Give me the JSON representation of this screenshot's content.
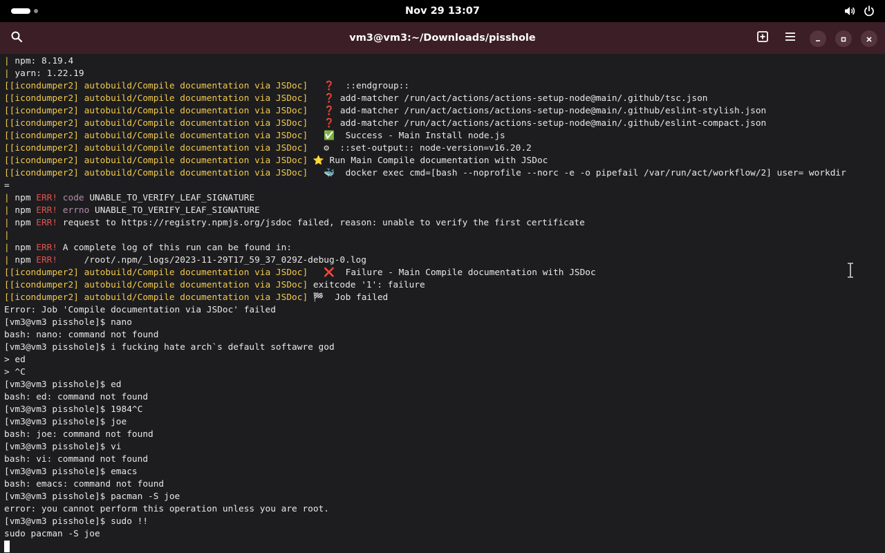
{
  "topbar": {
    "clock": "Nov 29  13:07",
    "icons": [
      "volume-icon",
      "power-icon"
    ]
  },
  "window": {
    "title": "vm3@vm3:~/Downloads/pisshole",
    "buttons": [
      "search-icon",
      "new-tab-icon",
      "menu-icon",
      "minimize-icon",
      "maximize-icon",
      "close-icon"
    ]
  },
  "colors": {
    "topbar_bg": "#000000",
    "headerbar_bg": "#3b1e26",
    "terminal_bg": "#1d1d1f",
    "prefix_yellow": "#f2c94c",
    "err_red": "#e0524f",
    "code_purple": "#b48ead"
  },
  "terminal": {
    "lines": [
      [
        {
          "t": "| ",
          "c": "y"
        },
        {
          "t": "npm: 8.19.4"
        }
      ],
      [
        {
          "t": "| ",
          "c": "y"
        },
        {
          "t": "yarn: 1.22.19"
        }
      ],
      [
        {
          "t": "[[icondumper2] autobuild/Compile documentation via JSDoc]",
          "c": "y"
        },
        {
          "t": "   ❓  ::endgroup::"
        }
      ],
      [
        {
          "t": "[[icondumper2] autobuild/Compile documentation via JSDoc]",
          "c": "y"
        },
        {
          "t": "   ❓ add-matcher /run/act/actions/actions-setup-node@main/.github/tsc.json"
        }
      ],
      [
        {
          "t": "[[icondumper2] autobuild/Compile documentation via JSDoc]",
          "c": "y"
        },
        {
          "t": "   ❓ add-matcher /run/act/actions/actions-setup-node@main/.github/eslint-stylish.json"
        }
      ],
      [
        {
          "t": "[[icondumper2] autobuild/Compile documentation via JSDoc]",
          "c": "y"
        },
        {
          "t": "   ❓ add-matcher /run/act/actions/actions-setup-node@main/.github/eslint-compact.json"
        }
      ],
      [
        {
          "t": "[[icondumper2] autobuild/Compile documentation via JSDoc]",
          "c": "y"
        },
        {
          "t": "   ✅  Success - Main Install node.js"
        }
      ],
      [
        {
          "t": "[[icondumper2] autobuild/Compile documentation via JSDoc]",
          "c": "y"
        },
        {
          "t": "   ⚙  ::set-output:: node-version=v16.20.2"
        }
      ],
      [
        {
          "t": "[[icondumper2] autobuild/Compile documentation via JSDoc]",
          "c": "y"
        },
        {
          "t": " ⭐ Run Main Compile documentation with JSDoc"
        }
      ],
      [
        {
          "t": "[[icondumper2] autobuild/Compile documentation via JSDoc]",
          "c": "y"
        },
        {
          "t": "   🐳  docker exec cmd=[bash --noprofile --norc -e -o pipefail /var/run/act/workflow/2] user= workdir"
        }
      ],
      [
        {
          "t": "="
        }
      ],
      [
        {
          "t": "| ",
          "c": "y"
        },
        {
          "t": "npm "
        },
        {
          "t": "ERR!",
          "c": "red"
        },
        {
          "t": " "
        },
        {
          "t": "code",
          "c": "purple"
        },
        {
          "t": " UNABLE_TO_VERIFY_LEAF_SIGNATURE"
        }
      ],
      [
        {
          "t": "| ",
          "c": "y"
        },
        {
          "t": "npm "
        },
        {
          "t": "ERR!",
          "c": "red"
        },
        {
          "t": " "
        },
        {
          "t": "errno",
          "c": "purple"
        },
        {
          "t": " UNABLE_TO_VERIFY_LEAF_SIGNATURE"
        }
      ],
      [
        {
          "t": "| ",
          "c": "y"
        },
        {
          "t": "npm "
        },
        {
          "t": "ERR!",
          "c": "red"
        },
        {
          "t": " request to https://registry.npmjs.org/jsdoc failed, reason: unable to verify the first certificate"
        }
      ],
      [
        {
          "t": "| ",
          "c": "y"
        }
      ],
      [
        {
          "t": "| ",
          "c": "y"
        },
        {
          "t": "npm "
        },
        {
          "t": "ERR!",
          "c": "red"
        },
        {
          "t": " A complete log of this run can be found in:"
        }
      ],
      [
        {
          "t": "| ",
          "c": "y"
        },
        {
          "t": "npm "
        },
        {
          "t": "ERR!",
          "c": "red"
        },
        {
          "t": "     /root/.npm/_logs/2023-11-29T17_59_37_029Z-debug-0.log"
        }
      ],
      [
        {
          "t": "[[icondumper2] autobuild/Compile documentation via JSDoc]",
          "c": "y"
        },
        {
          "t": "   ❌  Failure - Main Compile documentation with JSDoc"
        }
      ],
      [
        {
          "t": "[[icondumper2] autobuild/Compile documentation via JSDoc]",
          "c": "y"
        },
        {
          "t": " exitcode '1': failure"
        }
      ],
      [
        {
          "t": "[[icondumper2] autobuild/Compile documentation via JSDoc]",
          "c": "y"
        },
        {
          "t": " 🏁  Job failed"
        }
      ],
      [
        {
          "t": "Error: Job 'Compile documentation via JSDoc' failed"
        }
      ],
      [
        {
          "t": "[vm3@vm3 pisshole]$ nano"
        }
      ],
      [
        {
          "t": "bash: nano: command not found"
        }
      ],
      [
        {
          "t": "[vm3@vm3 pisshole]$ i fucking hate arch`s default softawre god"
        }
      ],
      [
        {
          "t": "> ed"
        }
      ],
      [
        {
          "t": "> ^C"
        }
      ],
      [
        {
          "t": "[vm3@vm3 pisshole]$ ed"
        }
      ],
      [
        {
          "t": "bash: ed: command not found"
        }
      ],
      [
        {
          "t": "[vm3@vm3 pisshole]$ 1984^C"
        }
      ],
      [
        {
          "t": "[vm3@vm3 pisshole]$ joe"
        }
      ],
      [
        {
          "t": "bash: joe: command not found"
        }
      ],
      [
        {
          "t": "[vm3@vm3 pisshole]$ vi"
        }
      ],
      [
        {
          "t": "bash: vi: command not found"
        }
      ],
      [
        {
          "t": "[vm3@vm3 pisshole]$ emacs"
        }
      ],
      [
        {
          "t": "bash: emacs: command not found"
        }
      ],
      [
        {
          "t": "[vm3@vm3 pisshole]$ pacman -S joe"
        }
      ],
      [
        {
          "t": "error: you cannot perform this operation unless you are root."
        }
      ],
      [
        {
          "t": "[vm3@vm3 pisshole]$ sudo !!"
        }
      ],
      [
        {
          "t": "sudo pacman -S joe"
        }
      ]
    ]
  }
}
